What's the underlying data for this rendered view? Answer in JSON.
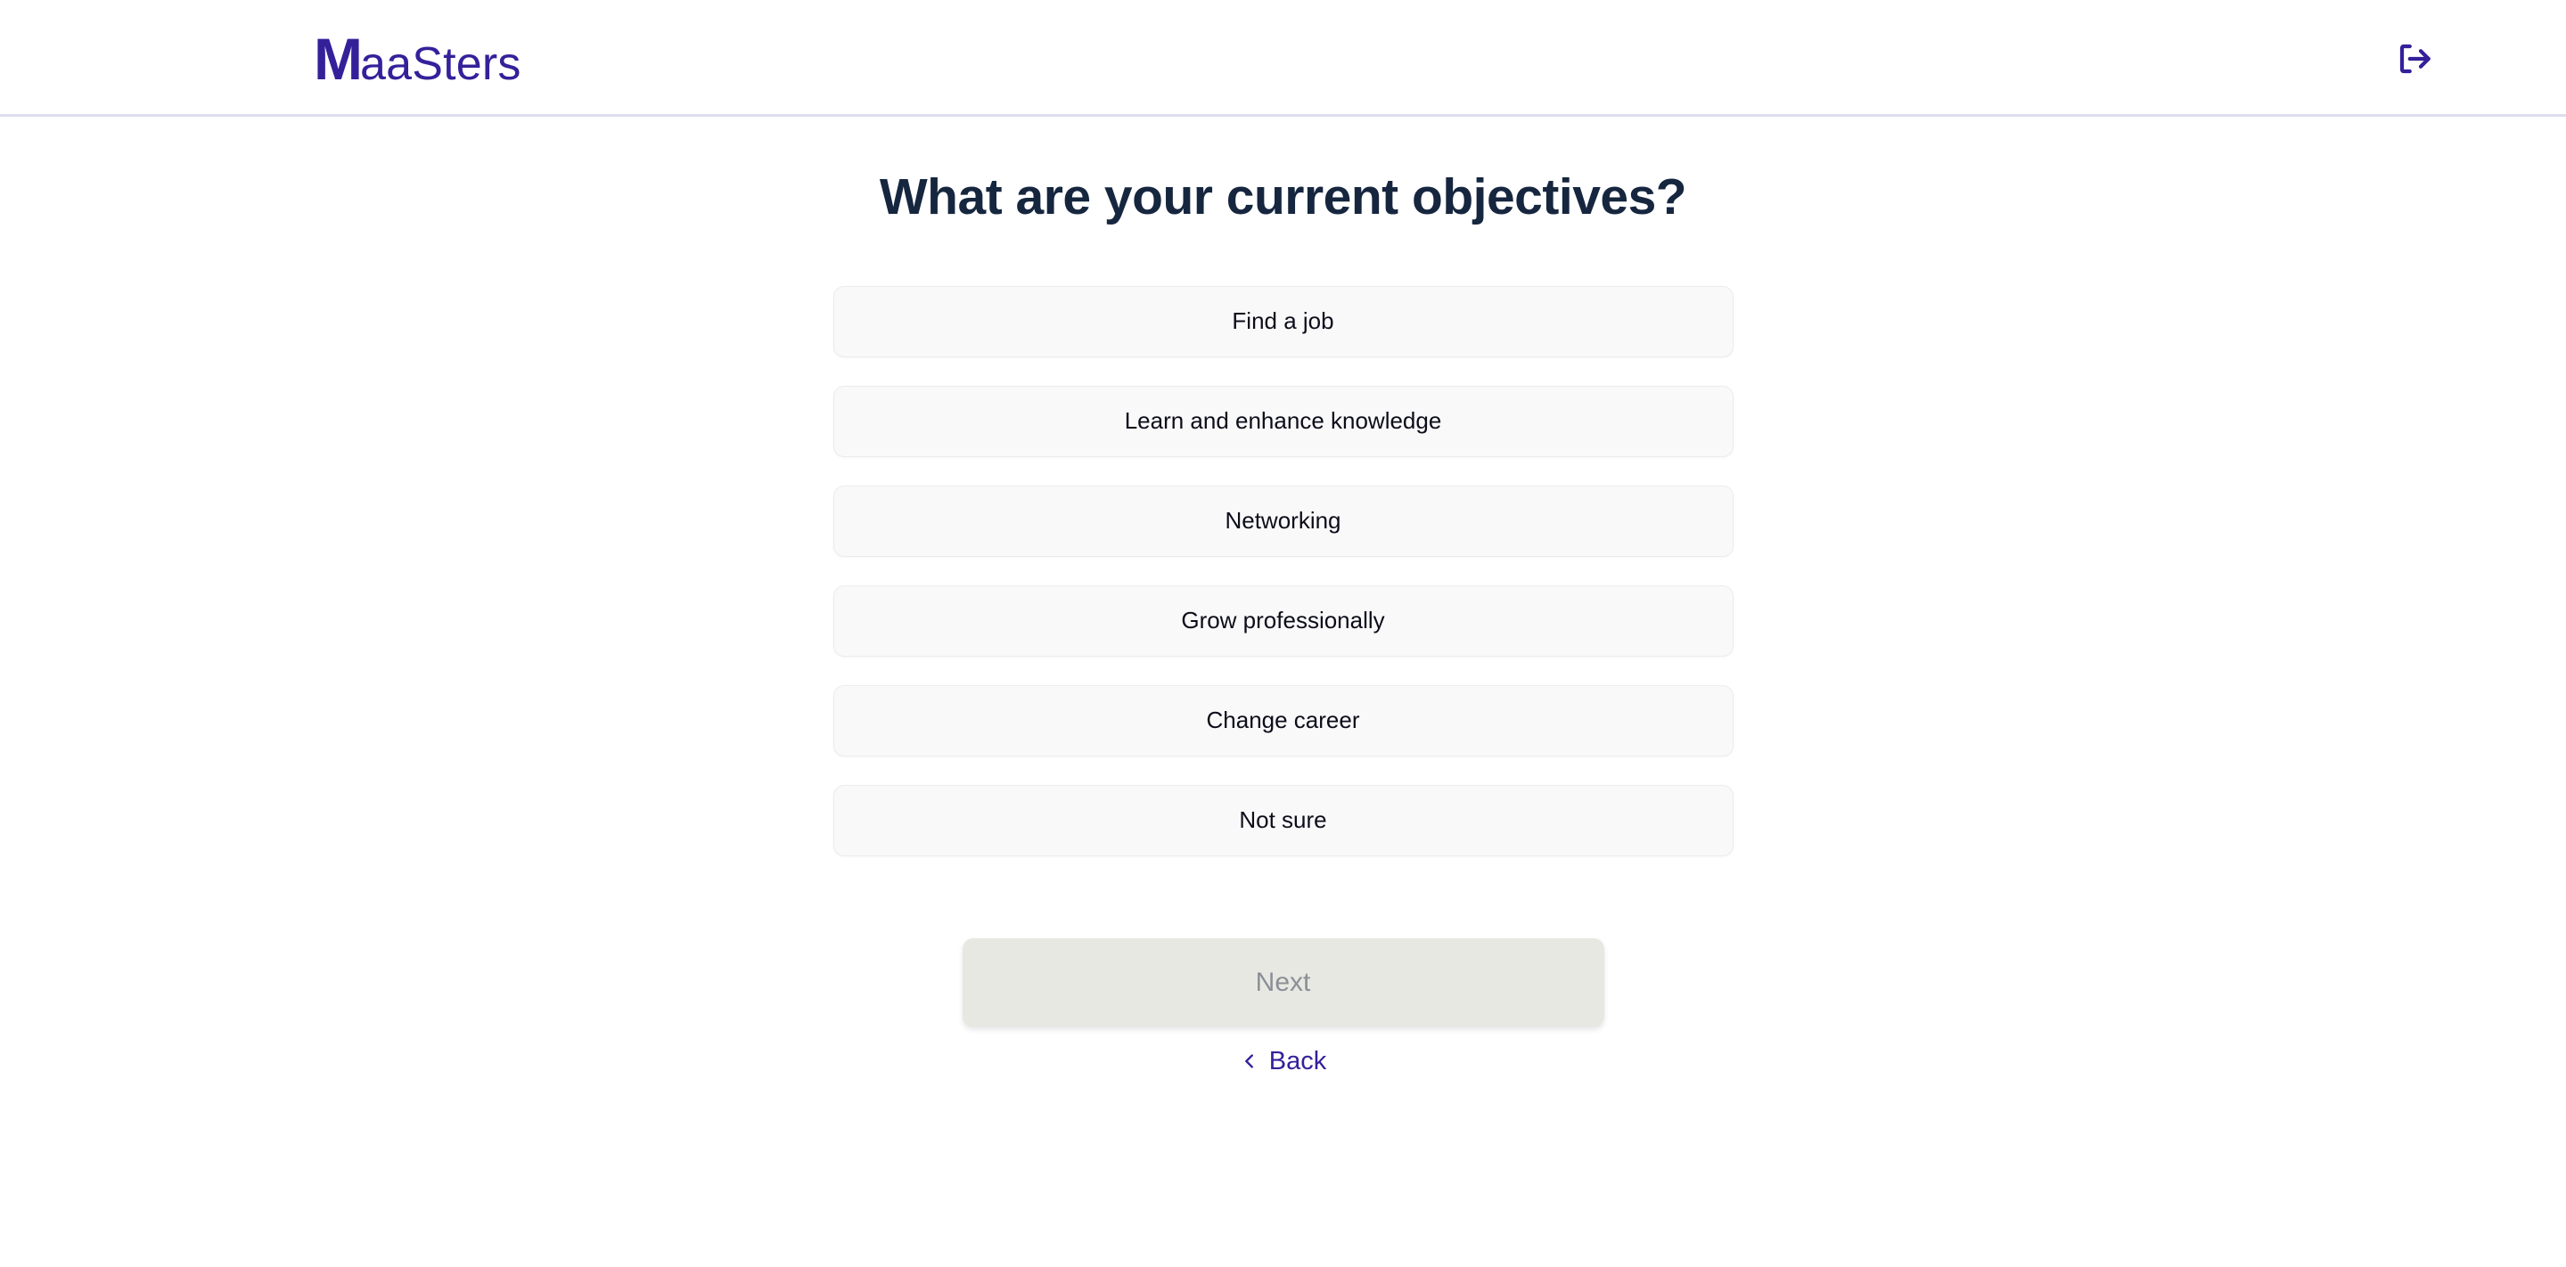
{
  "header": {
    "logo": {
      "initial": "M",
      "rest": "aaSters",
      "full_text": "MaaSters",
      "color": "#34219a"
    },
    "logout": {
      "icon": "logout-icon",
      "label": "Log out"
    },
    "border_color": "#dedcf0"
  },
  "main": {
    "title": "What are your current objectives?",
    "title_color": "#16263f",
    "options": [
      {
        "label": "Find a job",
        "selected": false
      },
      {
        "label": "Learn and enhance knowledge",
        "selected": false
      },
      {
        "label": "Networking",
        "selected": false
      },
      {
        "label": "Grow professionally",
        "selected": false
      },
      {
        "label": "Change career",
        "selected": false
      },
      {
        "label": "Not sure",
        "selected": false
      }
    ],
    "option_bg": "#f9f9fa",
    "option_text_color": "#0d0d1a"
  },
  "footer": {
    "next": {
      "label": "Next",
      "disabled": true,
      "bg": "#e8e8e3",
      "text_color": "#8b8f96"
    },
    "back": {
      "label": "Back",
      "icon": "chevron-left-icon",
      "color": "#34219a"
    }
  }
}
